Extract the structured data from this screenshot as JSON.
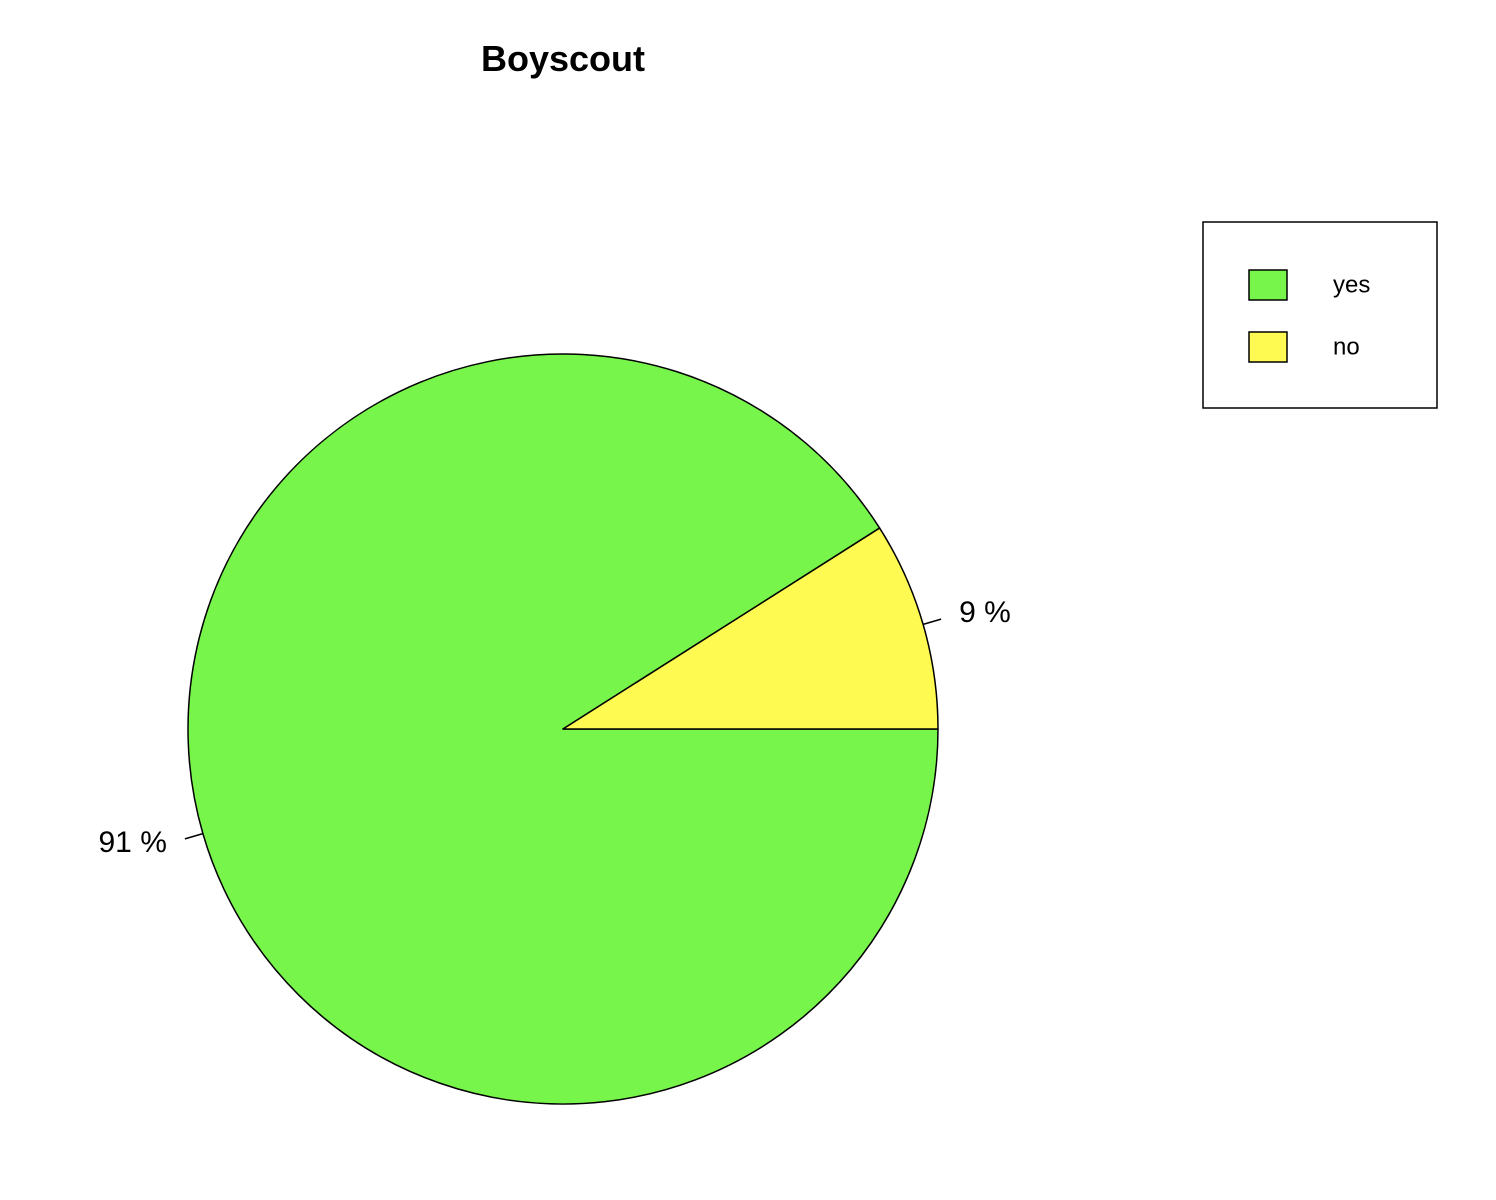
{
  "chart_data": {
    "type": "pie",
    "title": "Boyscout",
    "slices": [
      {
        "name": "yes",
        "value": 91,
        "label": "91 %",
        "color": "#77F54B"
      },
      {
        "name": "no",
        "value": 9,
        "label": "9 %",
        "color": "#FFFA52"
      }
    ],
    "start_angle_deg": 0,
    "direction": "clockwise",
    "legend": {
      "placement": "top-right",
      "entries": [
        "yes",
        "no"
      ]
    }
  }
}
